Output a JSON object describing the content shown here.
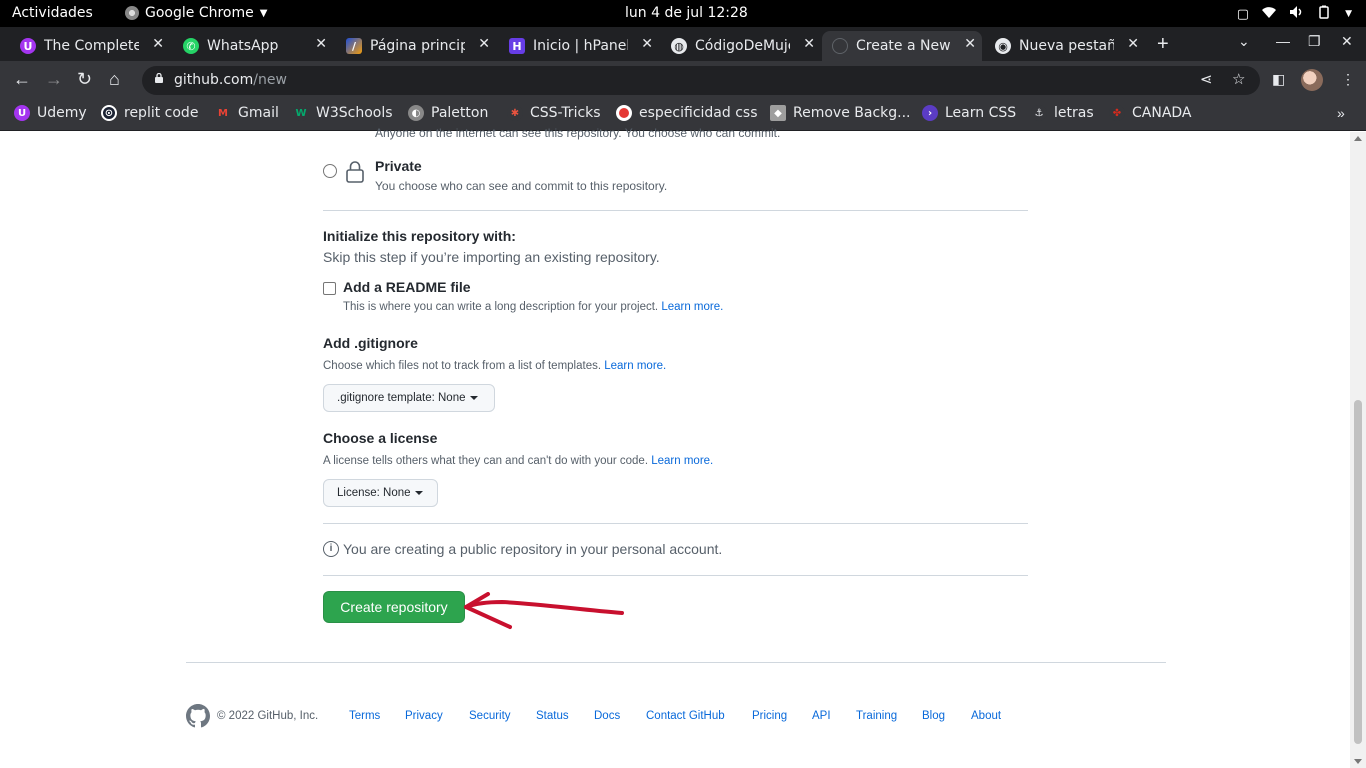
{
  "os_topbar": {
    "activities": "Actividades",
    "app_name": "Google Chrome",
    "clock": "lun  4 de jul  12:28"
  },
  "tabs": [
    {
      "title": "The Complete",
      "favicon": "udemy-icon",
      "active": false
    },
    {
      "title": "WhatsApp",
      "favicon": "whatsapp-icon",
      "active": false
    },
    {
      "title": "Página princip",
      "favicon": "bubble-icon",
      "active": false
    },
    {
      "title": "Inicio | hPanel",
      "favicon": "hostinger-icon",
      "active": false
    },
    {
      "title": "CódigoDeMuje",
      "favicon": "globe-icon",
      "active": false
    },
    {
      "title": "Create a New R",
      "favicon": "github-icon",
      "active": true
    },
    {
      "title": "Nueva pestaña",
      "favicon": "chrome-icon",
      "active": false
    }
  ],
  "omnibox": {
    "host": "github.com",
    "path": "/new"
  },
  "bookmarks": [
    {
      "label": "Udemy",
      "icon": "udemy-icon",
      "color": "#a435f0"
    },
    {
      "label": "replit code",
      "icon": "replit-icon",
      "color": "#1c2333"
    },
    {
      "label": "Gmail",
      "icon": "gmail-icon",
      "color": "#ea4335"
    },
    {
      "label": "W3Schools",
      "icon": "w3schools-icon",
      "color": "#04aa6d"
    },
    {
      "label": "Paletton",
      "icon": "paletton-icon",
      "color": "#888888"
    },
    {
      "label": "CSS-Tricks",
      "icon": "csstricks-icon",
      "color": "#e8533f"
    },
    {
      "label": "especificidad css",
      "icon": "record-icon",
      "color": "#e53935"
    },
    {
      "label": "Remove Backg...",
      "icon": "removebg-icon",
      "color": "#9e9e9e"
    },
    {
      "label": "Learn CSS",
      "icon": "learncss-icon",
      "color": "#5b3cc4"
    },
    {
      "label": "letras",
      "icon": "anchor-icon",
      "color": "#444444"
    },
    {
      "label": "CANADA",
      "icon": "maple-leaf-icon",
      "color": "#d52b1e"
    }
  ],
  "form": {
    "cut_text": "Anyone on the internet can see this repository. You choose who can commit.",
    "private_title": "Private",
    "private_desc": "You choose who can see and commit to this repository.",
    "init_title": "Initialize this repository with:",
    "init_sub": "Skip this step if you’re importing an existing repository.",
    "readme_title": "Add a README file",
    "readme_desc": "This is where you can write a long description for your project.",
    "learn_more": "Learn more.",
    "gitignore_title": "Add .gitignore",
    "gitignore_desc": "Choose which files not to track from a list of templates.",
    "gitignore_select": ".gitignore template: None",
    "license_title": "Choose a license",
    "license_desc": "A license tells others what they can and can't do with your code.",
    "license_select": "License: None",
    "info_text": "You are creating a public repository in your personal account.",
    "create_button": "Create repository"
  },
  "footer": {
    "copyright": "© 2022 GitHub, Inc.",
    "links": [
      "Terms",
      "Privacy",
      "Security",
      "Status",
      "Docs",
      "Contact GitHub",
      "Pricing",
      "API",
      "Training",
      "Blog",
      "About"
    ]
  },
  "colors": {
    "primary_button": "#2da44e",
    "link": "#0969da",
    "annotation_arrow": "#c8102e"
  }
}
